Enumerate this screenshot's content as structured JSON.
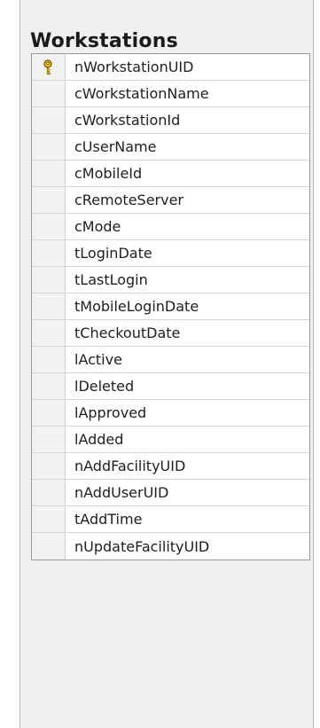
{
  "table": {
    "title": "Workstations",
    "columns": [
      {
        "name": "nWorkstationUID",
        "is_key": true,
        "icon": "primary-key-icon"
      },
      {
        "name": "cWorkstationName",
        "is_key": false
      },
      {
        "name": "cWorkstationId",
        "is_key": false
      },
      {
        "name": "cUserName",
        "is_key": false
      },
      {
        "name": "cMobileId",
        "is_key": false
      },
      {
        "name": "cRemoteServer",
        "is_key": false
      },
      {
        "name": "cMode",
        "is_key": false
      },
      {
        "name": "tLoginDate",
        "is_key": false
      },
      {
        "name": "tLastLogin",
        "is_key": false
      },
      {
        "name": "tMobileLoginDate",
        "is_key": false
      },
      {
        "name": "tCheckoutDate",
        "is_key": false
      },
      {
        "name": "lActive",
        "is_key": false
      },
      {
        "name": "lDeleted",
        "is_key": false
      },
      {
        "name": "lApproved",
        "is_key": false
      },
      {
        "name": "lAdded",
        "is_key": false
      },
      {
        "name": "nAddFacilityUID",
        "is_key": false
      },
      {
        "name": "nAddUserUID",
        "is_key": false
      },
      {
        "name": "tAddTime",
        "is_key": false
      },
      {
        "name": "nUpdateFacilityUID",
        "is_key": false
      }
    ]
  },
  "colors": {
    "key_icon_fill": "#f3c300",
    "key_icon_stroke": "#6b5200"
  }
}
